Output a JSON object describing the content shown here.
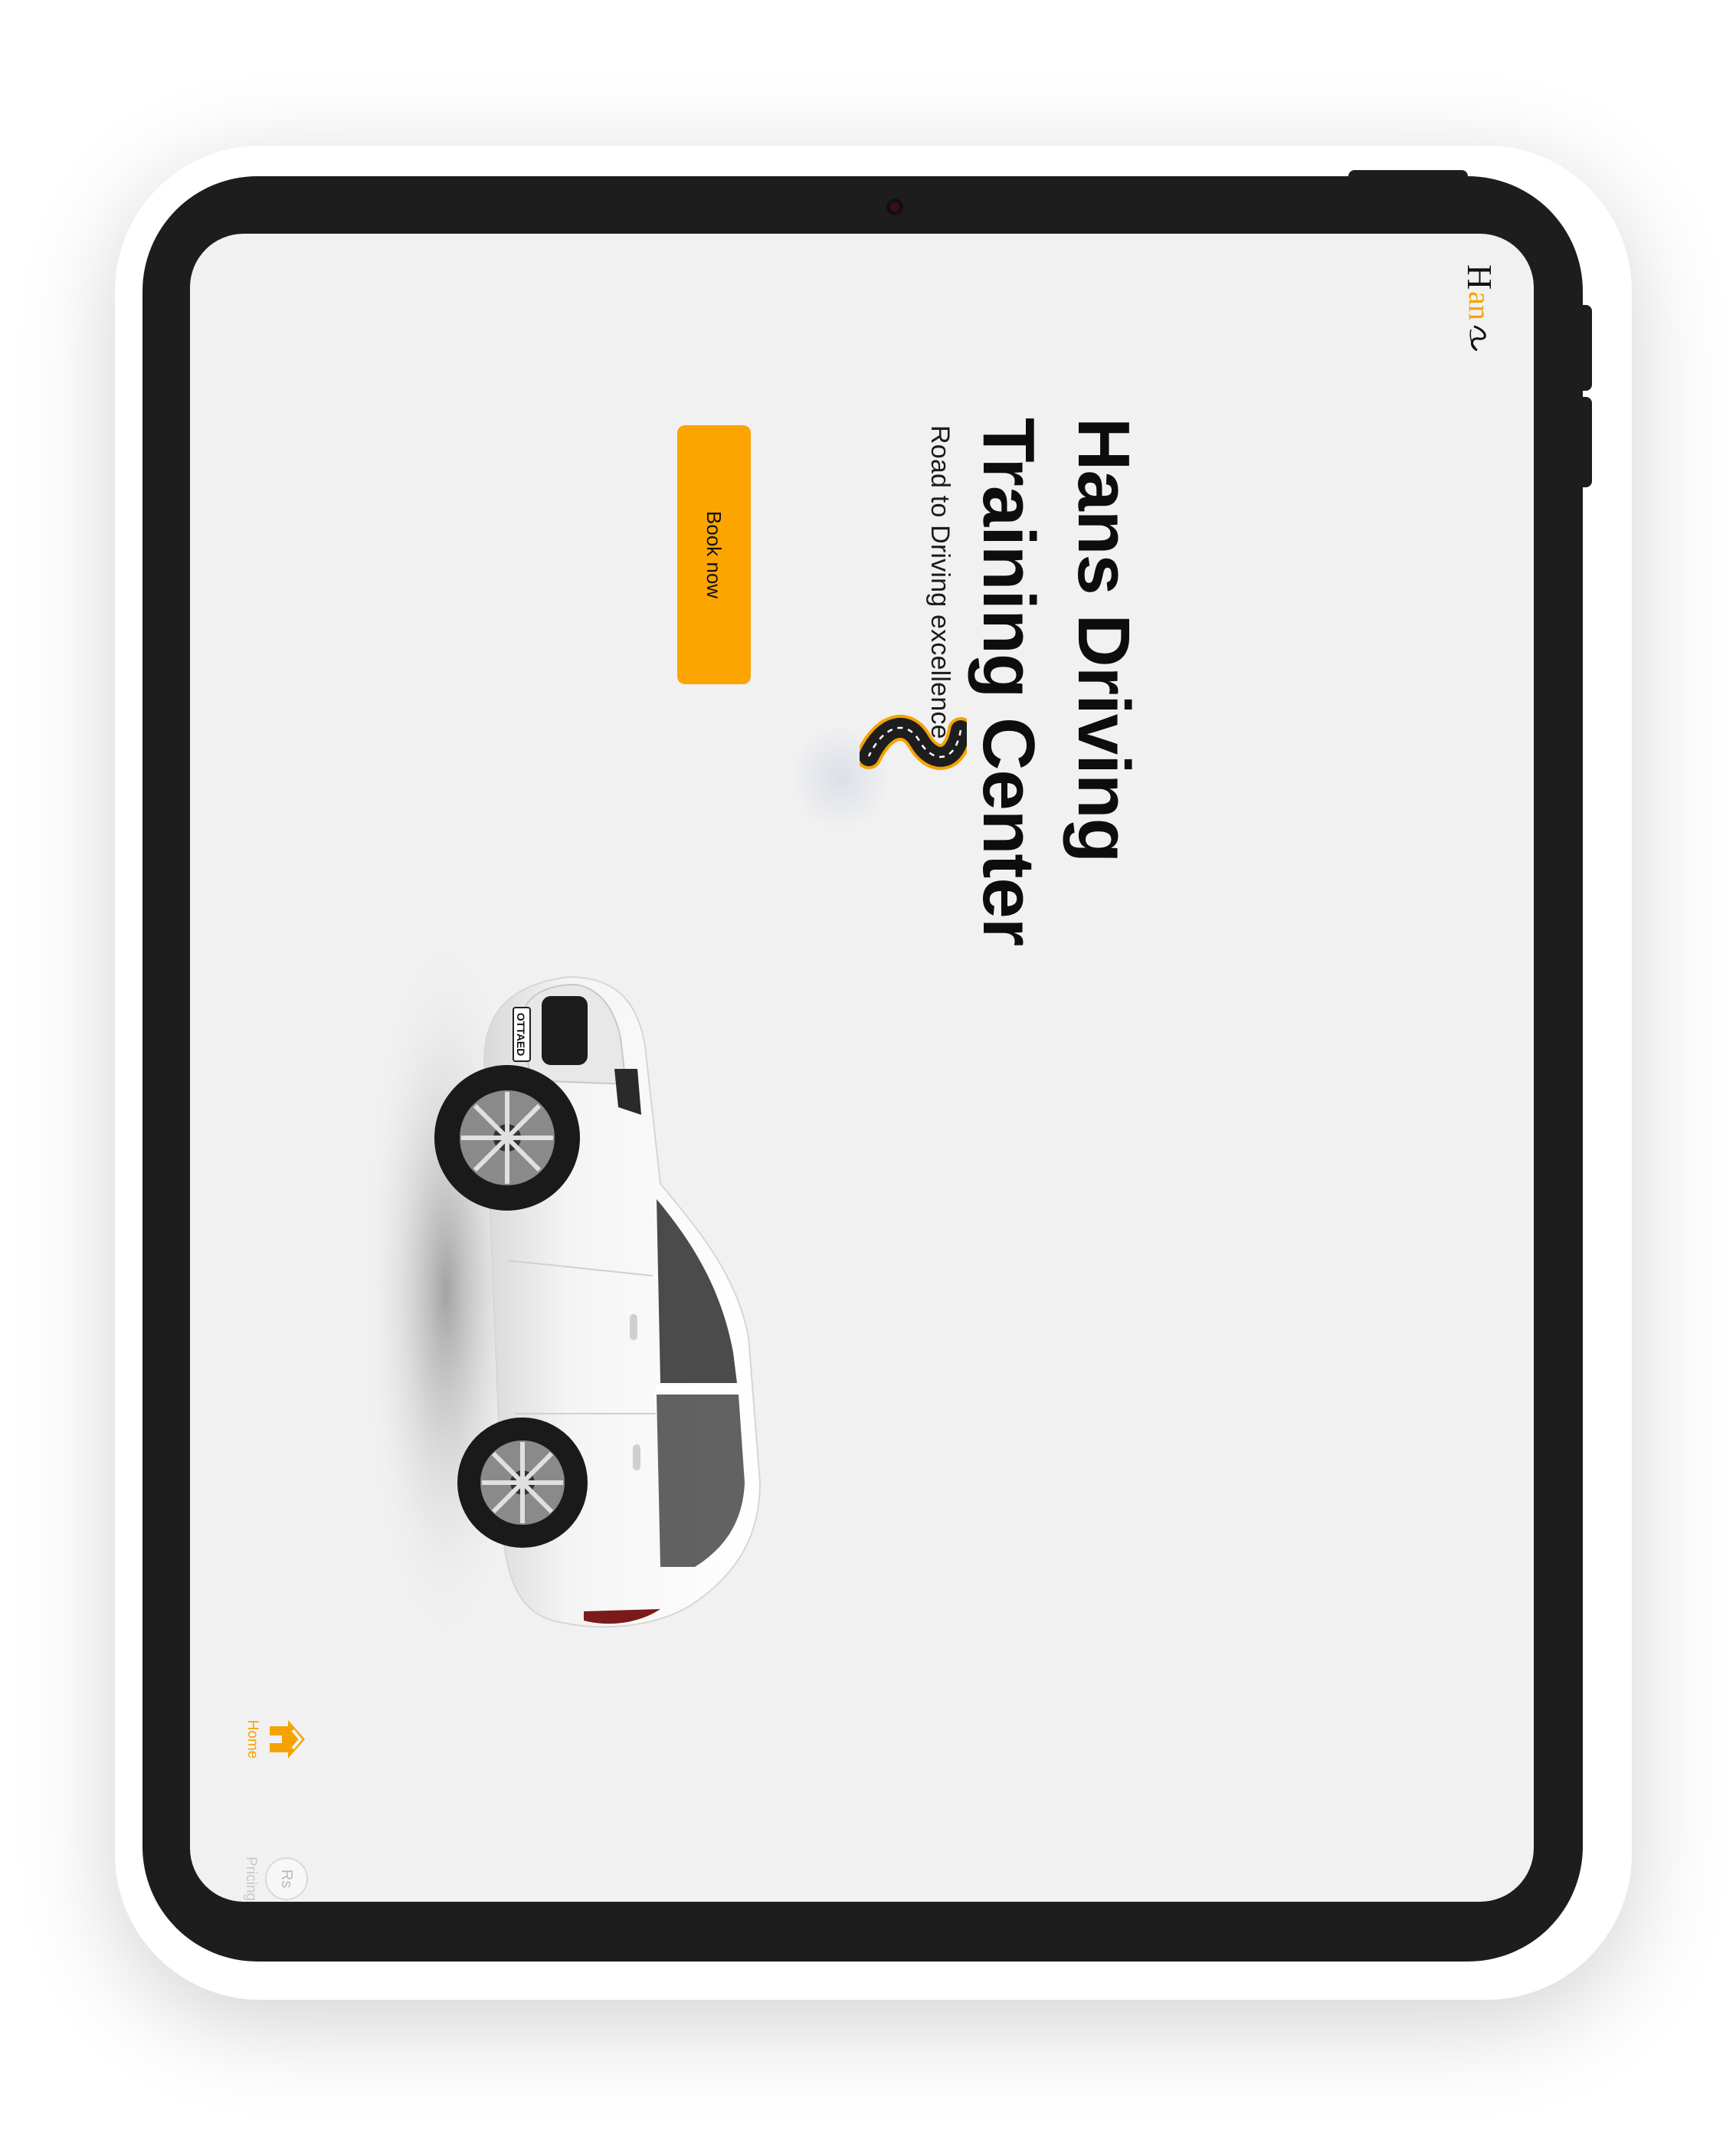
{
  "logo": {
    "letter": "H",
    "rest": "an"
  },
  "hero": {
    "title": "Hans Driving Training Center",
    "tagline": "Road to Driving excellence",
    "book_label": "Book now"
  },
  "car": {
    "plate": "OTTAED"
  },
  "nav": {
    "items": [
      {
        "label": "Home",
        "state": "active"
      },
      {
        "label": "Pricing",
        "badge": "Rs",
        "state": "inactive"
      }
    ]
  },
  "colors": {
    "accent": "#fca500",
    "device": "#1d1d1d",
    "screen_bg": "#f1f1f1",
    "text": "#0d0d0d"
  },
  "icons": [
    "swoosh-logo-icon",
    "road-icon",
    "home-icon",
    "rupee-badge-icon",
    "camera-icon"
  ]
}
